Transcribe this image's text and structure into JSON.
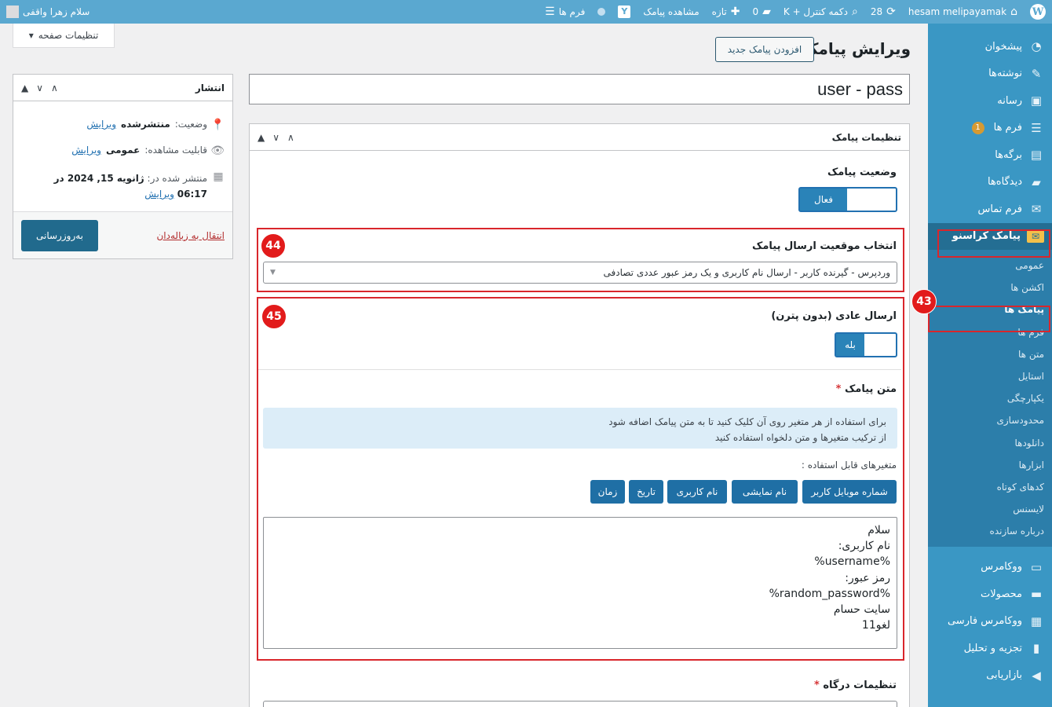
{
  "admin_bar": {
    "site_name": "hesam melipayamak",
    "updates_count": "28",
    "dashboard_shortcut": "دکمه کنترل + K",
    "comments_count": "0",
    "new_label": "تازه",
    "view_sms": "مشاهده پیامک",
    "forms": "فرم ها",
    "greeting": "سلام زهرا واقفی"
  },
  "screen_options": "تنظیمات صفحه",
  "page_title": "ویرایش پیامک",
  "add_new_button": "افزودن پیامک جدید",
  "post_title": "user - pass",
  "sidebar": {
    "items_top": [
      {
        "label": "پیشخوان",
        "icon": "dashboard-icon"
      },
      {
        "label": "نوشته‌ها",
        "icon": "pin-icon"
      },
      {
        "label": "رسانه",
        "icon": "media-icon"
      },
      {
        "label": "فرم ها",
        "icon": "forms-icon",
        "badge": "1"
      },
      {
        "label": "برگه‌ها",
        "icon": "pages-icon"
      },
      {
        "label": "دیدگاه‌ها",
        "icon": "comments-icon"
      },
      {
        "label": "فرم تماس",
        "icon": "mail-icon"
      },
      {
        "label": "پیامک کراسنو",
        "icon": "envelope-icon"
      }
    ],
    "submenu": [
      "عمومی",
      "اکشن ها",
      "پیامک ها",
      "فرم ها",
      "متن ها",
      "استایل",
      "یکپارچگی",
      "محدودسازی",
      "دانلودها",
      "ابزارها",
      "کدهای کوتاه",
      "لایسنس",
      "درباره سازنده"
    ],
    "items_bottom": [
      {
        "label": "ووکامرس",
        "icon": "woo-icon"
      },
      {
        "label": "محصولات",
        "icon": "products-icon"
      },
      {
        "label": "ووکامرس فارسی",
        "icon": "persian-woo-icon"
      },
      {
        "label": "تجزیه و تحلیل",
        "icon": "analytics-icon"
      },
      {
        "label": "بازاریابی",
        "icon": "megaphone-icon"
      }
    ]
  },
  "publish": {
    "title": "انتشار",
    "status_label": "وضعیت:",
    "status_value": "منتشرشده",
    "visibility_label": "قابلیت مشاهده:",
    "visibility_value": "عمومی",
    "published_label": "منتشر شده در:",
    "published_date": "ژانویه 15, 2024 در",
    "published_time": "06:17",
    "edit_link": "ویرایش",
    "trash_link": "انتقال به زباله‌دان",
    "update_button": "به‌روزرسانی"
  },
  "settings": {
    "title": "تنظیمات پیامک",
    "status_label": "وضعیت پیامک",
    "status_toggle": "فعال",
    "location_label": "انتخاب موقعیت ارسال پیامک",
    "location_value": "وردپرس - گیرنده کاربر - ارسال نام کاربری و یک رمز عبور عددی تصادفی",
    "normal_send_label": "ارسال عادی (بدون پترن)",
    "normal_send_toggle": "بله",
    "message_label": "متن پیامک",
    "info_line1": "برای استفاده از هر متغیر روی آن کلیک کنید تا به متن پیامک اضافه شود",
    "info_line2": "از ترکیب متغیرها و متن دلخواه استفاده کنید",
    "vars_label": "متغیرهای قابل استفاده :",
    "vars": [
      "شماره موبایل کاربر",
      "نام نمایشی",
      "نام کاربری",
      "تاریخ",
      "زمان"
    ],
    "message_lines": [
      "سلام",
      "نام کاربری:",
      "%username%",
      "رمز عبور:",
      "%random_password%",
      "سایت حسام",
      "لغو11"
    ],
    "gateway_label": "تنظیمات درگاه"
  },
  "annotations": [
    "43",
    "44",
    "45"
  ],
  "colors": {
    "admin_bar": "#5aa8d0",
    "sidebar": "#3a97c4",
    "highlight_red": "#d9262c",
    "primary_button": "#1f6fa5"
  }
}
